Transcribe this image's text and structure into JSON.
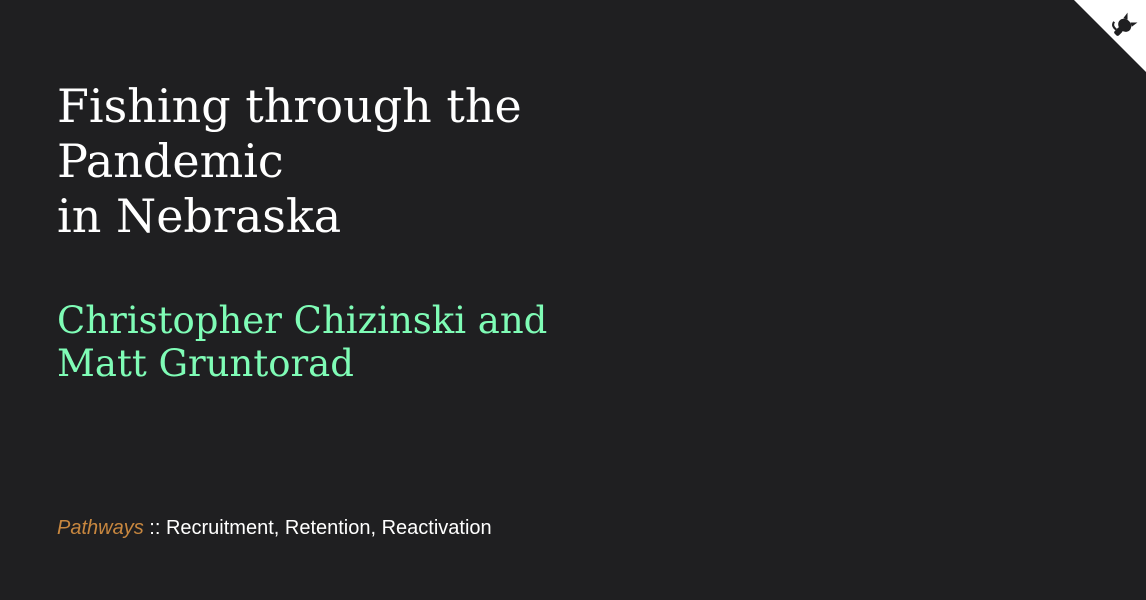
{
  "title": {
    "line1": "Fishing through the",
    "line2": "Pandemic",
    "line3": "in Nebraska"
  },
  "authors": {
    "line1": "Christopher Chizinski and",
    "line2": "Matt Gruntorad"
  },
  "footer": {
    "brand": "Pathways",
    "text": " :: Recruitment, Retention, Reactivation"
  },
  "corner": {
    "icon": "github-octocat-icon",
    "fill": "#ffffff"
  },
  "colors": {
    "background": "#1f1f21",
    "title": "#ffffff",
    "authors": "#7ffcb6",
    "brand": "#c8873f"
  }
}
